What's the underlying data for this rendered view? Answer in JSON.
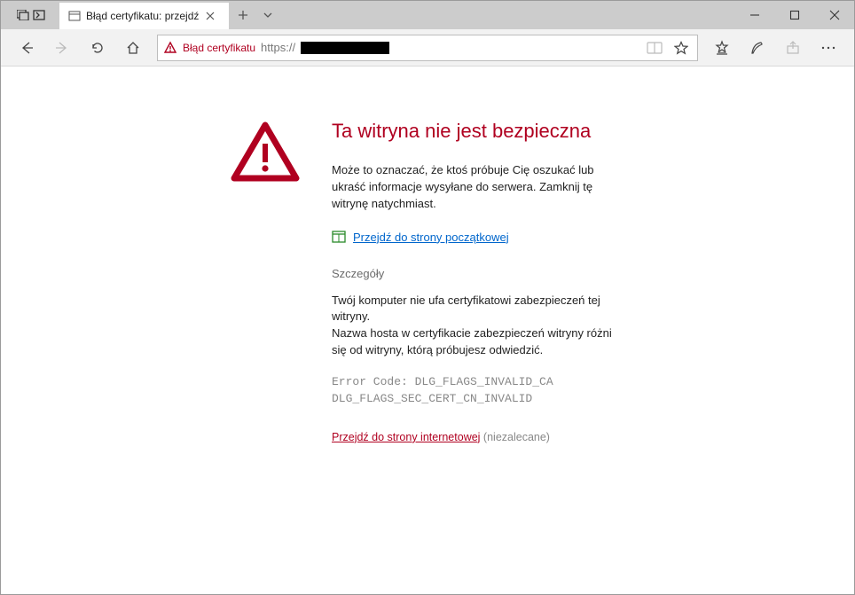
{
  "window": {
    "tab_title": "Błąd certyfikatu: przejdź"
  },
  "addressbar": {
    "cert_status": "Błąd certyfikatu",
    "url_prefix": "https://"
  },
  "error": {
    "title": "Ta witryna nie jest bezpieczna",
    "body": "Może to oznaczać, że ktoś próbuje Cię oszukać lub ukraść informacje wysyłane do serwera. Zamknij tę witrynę natychmiast.",
    "home_link": "Przejdź do strony początkowej",
    "details_heading": "Szczegóły",
    "details_text": "Twój komputer nie ufa certyfikatowi zabezpieczeń tej witryny.\nNazwa hosta w certyfikacie zabezpieczeń witryny różni się od witryny, którą próbujesz odwiedzić.",
    "error_code": "Error Code: DLG_FLAGS_INVALID_CA\nDLG_FLAGS_SEC_CERT_CN_INVALID",
    "proceed_link": "Przejdź do strony internetowej",
    "proceed_note": " (niezalecane)"
  }
}
